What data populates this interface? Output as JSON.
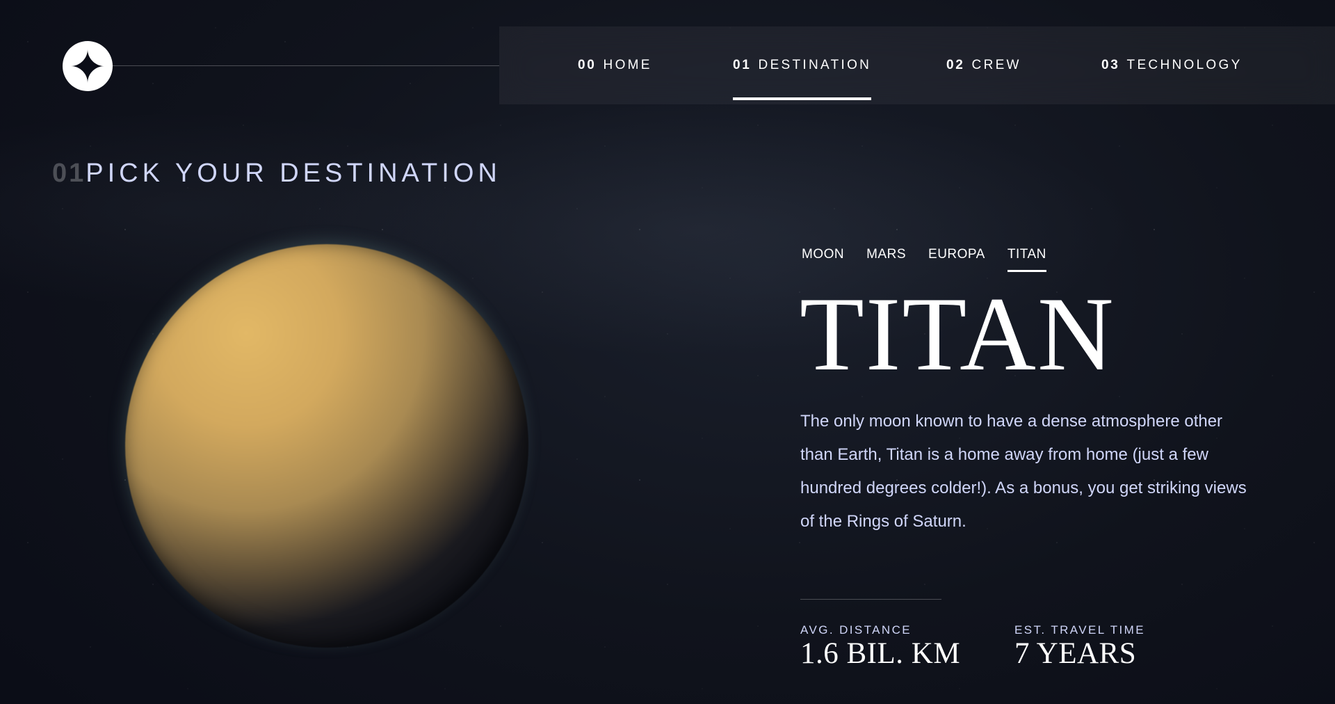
{
  "header": {
    "logo": "star-logo",
    "nav": [
      {
        "number": "00",
        "label": "HOME"
      },
      {
        "number": "01",
        "label": "DESTINATION",
        "active": true
      },
      {
        "number": "02",
        "label": "CREW"
      },
      {
        "number": "03",
        "label": "TECHNOLOGY"
      }
    ]
  },
  "main": {
    "heading_number": "01",
    "heading_text": "PICK YOUR DESTINATION",
    "planet_image": "titan-planet",
    "tabs": [
      {
        "label": "MOON"
      },
      {
        "label": "MARS"
      },
      {
        "label": "EUROPA"
      },
      {
        "label": "TITAN",
        "active": true
      }
    ],
    "planet_name": "TITAN",
    "description": "The only moon known to have a dense atmosphere other than Earth, Titan is a home away from home (just a few hundred degrees colder!). As a bonus, you get striking views of the Rings of Saturn.",
    "stats": {
      "distance_label": "AVG. DISTANCE",
      "distance_value": "1.6 BIL. KM",
      "travel_label": "EST. TRAVEL TIME",
      "travel_value": "7 YEARS"
    }
  },
  "colors": {
    "background": "#0b0d17",
    "accent_text": "#d0d6f9",
    "white": "#ffffff"
  }
}
